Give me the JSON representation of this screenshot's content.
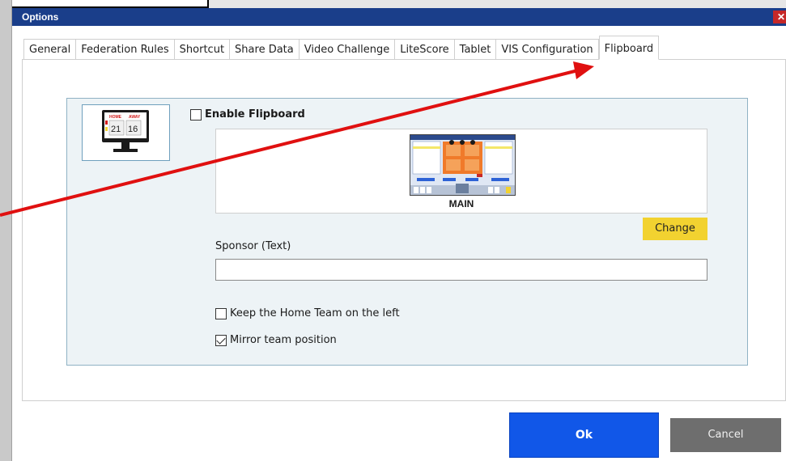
{
  "window": {
    "title": "Options",
    "close_glyph": "✕"
  },
  "tabs": [
    {
      "label": "General"
    },
    {
      "label": "Federation Rules"
    },
    {
      "label": "Shortcut"
    },
    {
      "label": "Share Data"
    },
    {
      "label": "Video Challenge"
    },
    {
      "label": "LiteScore"
    },
    {
      "label": "Tablet"
    },
    {
      "label": "VIS Configuration"
    },
    {
      "label": "Flipboard",
      "active": true
    }
  ],
  "flipboard": {
    "thumbnail": {
      "home_label": "HOME",
      "away_label": "AWAY",
      "home_score": "21",
      "away_score": "16"
    },
    "enable_label": "Enable Flipboard",
    "enable_checked": false,
    "preview_caption": "MAIN",
    "change_label": "Change",
    "sponsor_label": "Sponsor (Text)",
    "sponsor_value": "",
    "keep_home_left_label": "Keep the Home Team on the left",
    "keep_home_left_checked": false,
    "mirror_label": "Mirror team position",
    "mirror_checked": true
  },
  "footer": {
    "ok_label": "Ok",
    "cancel_label": "Cancel"
  },
  "colors": {
    "titlebar": "#1a3e8a",
    "ok": "#1157e8",
    "change": "#f2d230",
    "cancel": "#6e6e6e",
    "annotation_arrow": "#e01010"
  }
}
